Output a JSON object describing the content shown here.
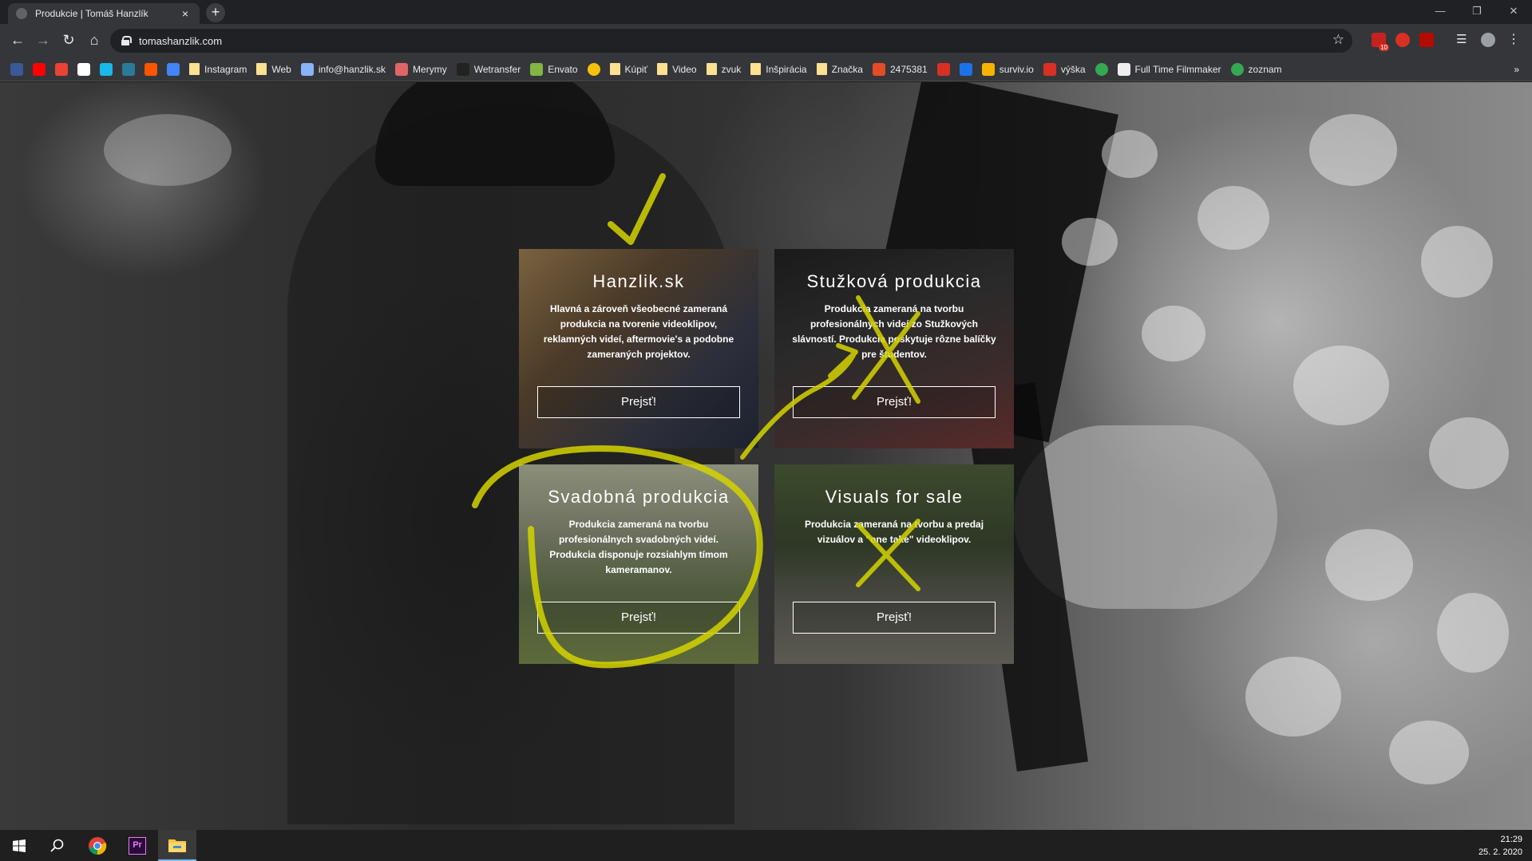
{
  "browser": {
    "tab_title": "Produkcie | Tomáš Hanzlík",
    "tab_close": "×",
    "new_tab": "+",
    "window_controls": [
      "—",
      "❐",
      "✕"
    ],
    "url": "tomashanzlik.com",
    "badge_count": "10",
    "bookmarks": [
      {
        "label": "",
        "icon": "facebook-icon",
        "color": "#3b5998"
      },
      {
        "label": "",
        "icon": "youtube-icon",
        "color": "#ff0000"
      },
      {
        "label": "",
        "icon": "gmail-icon",
        "color": "#ea4335"
      },
      {
        "label": "",
        "icon": "google-icon",
        "color": "#ffffff"
      },
      {
        "label": "",
        "icon": "vimeo-icon",
        "color": "#1ab7ea"
      },
      {
        "label": "",
        "icon": "app-icon",
        "color": "#2b7a9b"
      },
      {
        "label": "",
        "icon": "soundcloud-icon",
        "color": "#ff5500"
      },
      {
        "label": "",
        "icon": "translate-icon",
        "color": "#4285f4"
      },
      {
        "label": "Instagram",
        "icon": "folder-icon",
        "color": "#fbe190"
      },
      {
        "label": "Web",
        "icon": "folder-icon",
        "color": "#fbe190"
      },
      {
        "label": "info@hanzlik.sk",
        "icon": "mail-globe-icon",
        "color": "#8ab4f8"
      },
      {
        "label": "Merymy",
        "icon": "merymy-icon",
        "color": "#e06666"
      },
      {
        "label": "Wetransfer",
        "icon": "wetransfer-icon",
        "color": "#222222"
      },
      {
        "label": "Envato",
        "icon": "envato-icon",
        "color": "#82b541"
      },
      {
        "label": "",
        "icon": "loading-icon",
        "color": "#f4c20d"
      },
      {
        "label": "Kúpiť",
        "icon": "folder-icon",
        "color": "#fbe190"
      },
      {
        "label": "Video",
        "icon": "folder-icon",
        "color": "#fbe190"
      },
      {
        "label": "zvuk",
        "icon": "folder-icon",
        "color": "#fbe190"
      },
      {
        "label": "Inšpirácia",
        "icon": "folder-icon",
        "color": "#fbe190"
      },
      {
        "label": "Značka",
        "icon": "folder-icon",
        "color": "#fbe190"
      },
      {
        "label": "2475381",
        "icon": "phone-icon",
        "color": "#e34c26"
      },
      {
        "label": "",
        "icon": "lock-app-icon",
        "color": "#d93025"
      },
      {
        "label": "",
        "icon": "cloud-icon",
        "color": "#1a73e8"
      },
      {
        "label": "surviv.io",
        "icon": "surviv-icon",
        "color": "#f4b400"
      },
      {
        "label": "výška",
        "icon": "bookmark-red-icon",
        "color": "#d93025"
      },
      {
        "label": "",
        "icon": "circle-green-icon",
        "color": "#34a853"
      },
      {
        "label": "Full Time Filmmaker",
        "icon": "filmmaker-icon",
        "color": "#eeeeee"
      },
      {
        "label": "zoznam",
        "icon": "zoznam-icon",
        "color": "#34a853"
      }
    ],
    "more_bookmarks": "»"
  },
  "cards": [
    {
      "title": "Hanzlik.sk",
      "description": "Hlavná a zároveň všeobecné zameraná produkcia na tvorenie videoklipov, reklamných videí, aftermovie's a podobne zameraných projektov.",
      "button": "Prejsť!"
    },
    {
      "title": "Stužková produkcia",
      "description": "Produkcia zameraná na tvorbu profesionálnych videí zo Stužkových slávností. Produkcia poskytuje rôzne balíčky pre študentov.",
      "button": "Prejsť!"
    },
    {
      "title": "Svadobná produkcia",
      "description": "Produkcia zameraná na tvorbu profesionálnych svadobných videí. Produkcia disponuje rozsiahlym tímom kameramanov.",
      "button": "Prejsť!"
    },
    {
      "title": "Visuals for sale",
      "description": "Produkcia zameraná na tvorbu a predaj vizuálov a \"one take\" videoklipov.",
      "button": "Prejsť!"
    }
  ],
  "annotation_color": "#d4d400",
  "taskbar": {
    "time": "21:29",
    "date": "25. 2. 2020",
    "apps": [
      "windows-start-icon",
      "search-icon",
      "chrome-icon",
      "premiere-icon",
      "file-explorer-icon"
    ],
    "premiere_label": "Pr"
  }
}
